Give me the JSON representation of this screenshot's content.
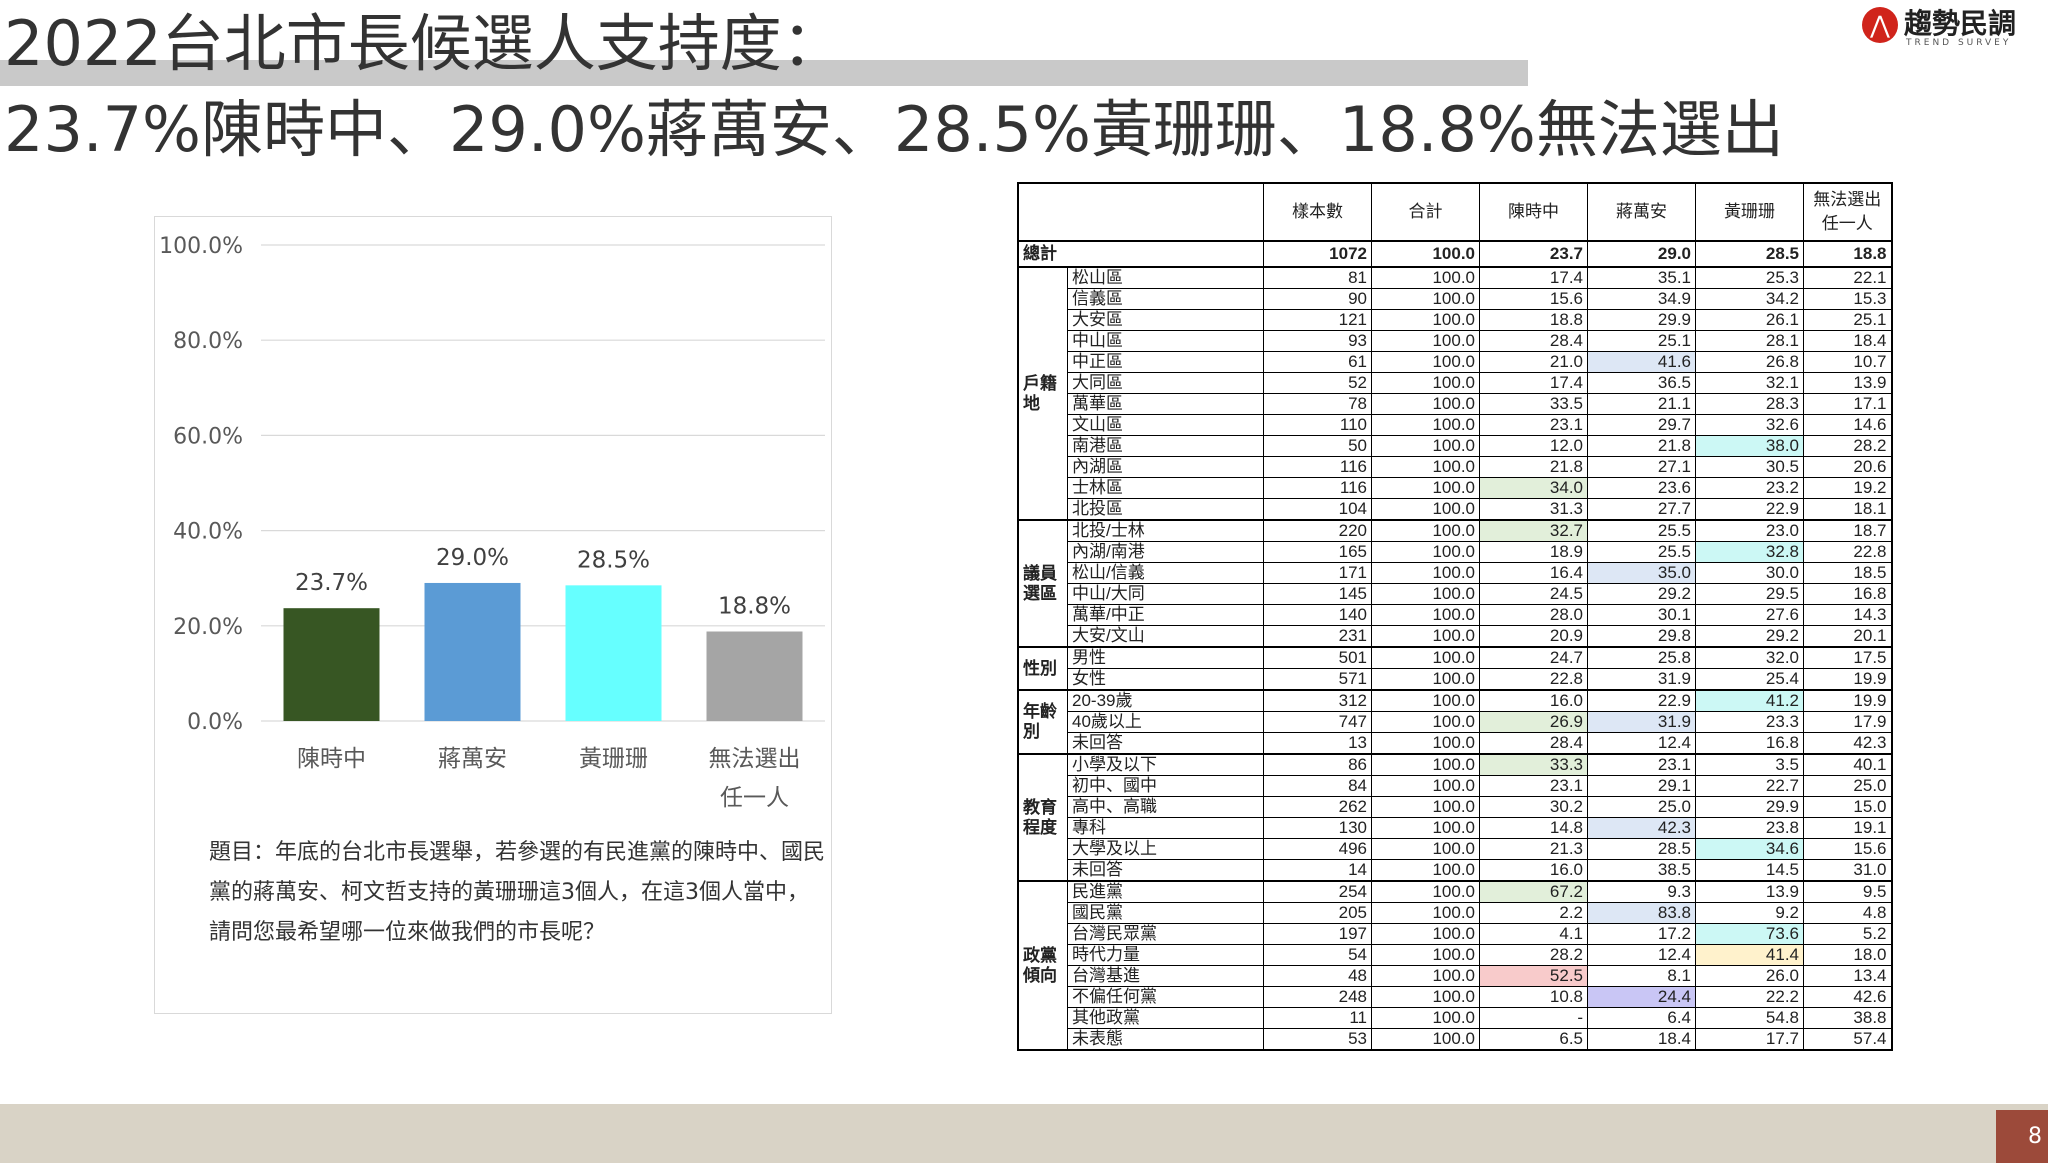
{
  "header": {
    "title_line1": "2022台北市長候選人支持度：",
    "title_line2": "23.7%陳時中、29.0%蔣萬安、28.5%黃珊珊、18.8%無法選出",
    "logo_text": "趨勢民調",
    "logo_sub": "TREND SURVEY",
    "page_number": "8"
  },
  "chart_data": {
    "type": "bar",
    "categories": [
      "陳時中",
      "蔣萬安",
      "黃珊珊",
      "無法選出任一人"
    ],
    "category_lines": [
      [
        "陳時中"
      ],
      [
        "蔣萬安"
      ],
      [
        "黃珊珊"
      ],
      [
        "無法選出",
        "任一人"
      ]
    ],
    "values": [
      23.7,
      29.0,
      28.5,
      18.8
    ],
    "value_labels": [
      "23.7%",
      "29.0%",
      "28.5%",
      "18.8%"
    ],
    "colors": [
      "#375623",
      "#5b9bd5",
      "#66ffff",
      "#a5a5a5"
    ],
    "ylim": [
      0,
      100
    ],
    "yticks": [
      0,
      20,
      40,
      60,
      80,
      100
    ],
    "ytick_labels": [
      "0.0%",
      "20.0%",
      "40.0%",
      "60.0%",
      "80.0%",
      "100.0%"
    ],
    "grid": true,
    "title": "",
    "xlabel": "",
    "ylabel": ""
  },
  "question": "題目：年底的台北市長選舉，若參選的有民進黨的陳時中、國民黨的蔣萬安、柯文哲支持的黃珊珊這3個人，在這3個人當中，請問您最希望哪一位來做我們的市長呢？",
  "table": {
    "headers": [
      "樣本數",
      "合計",
      "陳時中",
      "蔣萬安",
      "黃珊珊",
      "無法選出任一人"
    ],
    "total": {
      "label": "總計",
      "values": [
        "1072",
        "100.0",
        "23.7",
        "29.0",
        "28.5",
        "18.8"
      ]
    },
    "groups": [
      {
        "name": "戶籍地",
        "rows": [
          {
            "label": "松山區",
            "values": [
              "81",
              "100.0",
              "17.4",
              "35.1",
              "25.3",
              "22.1"
            ]
          },
          {
            "label": "信義區",
            "values": [
              "90",
              "100.0",
              "15.6",
              "34.9",
              "34.2",
              "15.3"
            ]
          },
          {
            "label": "大安區",
            "values": [
              "121",
              "100.0",
              "18.8",
              "29.9",
              "26.1",
              "25.1"
            ]
          },
          {
            "label": "中山區",
            "values": [
              "93",
              "100.0",
              "28.4",
              "25.1",
              "28.1",
              "18.4"
            ]
          },
          {
            "label": "中正區",
            "values": [
              "61",
              "100.0",
              "21.0",
              "41.6",
              "26.8",
              "10.7"
            ],
            "hl": {
              "3": "#dde7f5"
            }
          },
          {
            "label": "大同區",
            "values": [
              "52",
              "100.0",
              "17.4",
              "36.5",
              "32.1",
              "13.9"
            ]
          },
          {
            "label": "萬華區",
            "values": [
              "78",
              "100.0",
              "33.5",
              "21.1",
              "28.3",
              "17.1"
            ]
          },
          {
            "label": "文山區",
            "values": [
              "110",
              "100.0",
              "23.1",
              "29.7",
              "32.6",
              "14.6"
            ]
          },
          {
            "label": "南港區",
            "values": [
              "50",
              "100.0",
              "12.0",
              "21.8",
              "38.0",
              "28.2"
            ],
            "hl": {
              "4": "#ccf8f5"
            }
          },
          {
            "label": "內湖區",
            "values": [
              "116",
              "100.0",
              "21.8",
              "27.1",
              "30.5",
              "20.6"
            ]
          },
          {
            "label": "士林區",
            "values": [
              "116",
              "100.0",
              "34.0",
              "23.6",
              "23.2",
              "19.2"
            ],
            "hl": {
              "2": "#e2efda"
            }
          },
          {
            "label": "北投區",
            "values": [
              "104",
              "100.0",
              "31.3",
              "27.7",
              "22.9",
              "18.1"
            ]
          }
        ]
      },
      {
        "name": "議員選區",
        "rows": [
          {
            "label": "北投/士林",
            "values": [
              "220",
              "100.0",
              "32.7",
              "25.5",
              "23.0",
              "18.7"
            ],
            "hl": {
              "2": "#e2efda"
            }
          },
          {
            "label": "內湖/南港",
            "values": [
              "165",
              "100.0",
              "18.9",
              "25.5",
              "32.8",
              "22.8"
            ],
            "hl": {
              "4": "#ccf8f5"
            }
          },
          {
            "label": "松山/信義",
            "values": [
              "171",
              "100.0",
              "16.4",
              "35.0",
              "30.0",
              "18.5"
            ],
            "hl": {
              "3": "#dde7f5"
            }
          },
          {
            "label": "中山/大同",
            "values": [
              "145",
              "100.0",
              "24.5",
              "29.2",
              "29.5",
              "16.8"
            ]
          },
          {
            "label": "萬華/中正",
            "values": [
              "140",
              "100.0",
              "28.0",
              "30.1",
              "27.6",
              "14.3"
            ]
          },
          {
            "label": "大安/文山",
            "values": [
              "231",
              "100.0",
              "20.9",
              "29.8",
              "29.2",
              "20.1"
            ]
          }
        ]
      },
      {
        "name": "性別",
        "rows": [
          {
            "label": "男性",
            "values": [
              "501",
              "100.0",
              "24.7",
              "25.8",
              "32.0",
              "17.5"
            ]
          },
          {
            "label": "女性",
            "values": [
              "571",
              "100.0",
              "22.8",
              "31.9",
              "25.4",
              "19.9"
            ]
          }
        ]
      },
      {
        "name": "年齡別",
        "rows": [
          {
            "label": "20-39歲",
            "values": [
              "312",
              "100.0",
              "16.0",
              "22.9",
              "41.2",
              "19.9"
            ],
            "hl": {
              "4": "#ccf8f5"
            }
          },
          {
            "label": "40歲以上",
            "values": [
              "747",
              "100.0",
              "26.9",
              "31.9",
              "23.3",
              "17.9"
            ],
            "hl": {
              "2": "#e2efda",
              "3": "#dde7f5"
            }
          },
          {
            "label": "未回答",
            "values": [
              "13",
              "100.0",
              "28.4",
              "12.4",
              "16.8",
              "42.3"
            ]
          }
        ]
      },
      {
        "name": "教育程度",
        "rows": [
          {
            "label": "小學及以下",
            "values": [
              "86",
              "100.0",
              "33.3",
              "23.1",
              "3.5",
              "40.1"
            ],
            "hl": {
              "2": "#e2efda"
            }
          },
          {
            "label": "初中、國中",
            "values": [
              "84",
              "100.0",
              "23.1",
              "29.1",
              "22.7",
              "25.0"
            ]
          },
          {
            "label": "高中、高職",
            "values": [
              "262",
              "100.0",
              "30.2",
              "25.0",
              "29.9",
              "15.0"
            ]
          },
          {
            "label": "專科",
            "values": [
              "130",
              "100.0",
              "14.8",
              "42.3",
              "23.8",
              "19.1"
            ],
            "hl": {
              "3": "#dde7f5"
            }
          },
          {
            "label": "大學及以上",
            "values": [
              "496",
              "100.0",
              "21.3",
              "28.5",
              "34.6",
              "15.6"
            ],
            "hl": {
              "4": "#ccf8f5"
            }
          },
          {
            "label": "未回答",
            "values": [
              "14",
              "100.0",
              "16.0",
              "38.5",
              "14.5",
              "31.0"
            ]
          }
        ]
      },
      {
        "name": "政黨傾向",
        "rows": [
          {
            "label": "民進黨",
            "values": [
              "254",
              "100.0",
              "67.2",
              "9.3",
              "13.9",
              "9.5"
            ],
            "hl": {
              "2": "#e2efda"
            }
          },
          {
            "label": "國民黨",
            "values": [
              "205",
              "100.0",
              "2.2",
              "83.8",
              "9.2",
              "4.8"
            ],
            "hl": {
              "3": "#dde7f5"
            }
          },
          {
            "label": "台灣民眾黨",
            "values": [
              "197",
              "100.0",
              "4.1",
              "17.2",
              "73.6",
              "5.2"
            ],
            "hl": {
              "4": "#ccf8f5"
            }
          },
          {
            "label": "時代力量",
            "values": [
              "54",
              "100.0",
              "28.2",
              "12.4",
              "41.4",
              "18.0"
            ],
            "hl": {
              "4": "#fff2cc"
            }
          },
          {
            "label": "台灣基進",
            "values": [
              "48",
              "100.0",
              "52.5",
              "8.1",
              "26.0",
              "13.4"
            ],
            "hl": {
              "2": "#f8cbcb"
            }
          },
          {
            "label": "不偏任何黨",
            "values": [
              "248",
              "100.0",
              "10.8",
              "24.4",
              "22.2",
              "42.6"
            ],
            "hl": {
              "3": "#c9c6f5"
            }
          },
          {
            "label": "其他政黨",
            "values": [
              "11",
              "100.0",
              "-",
              "6.4",
              "54.8",
              "38.8"
            ]
          },
          {
            "label": "未表態",
            "values": [
              "53",
              "100.0",
              "6.5",
              "18.4",
              "17.7",
              "57.4"
            ]
          }
        ]
      }
    ]
  }
}
